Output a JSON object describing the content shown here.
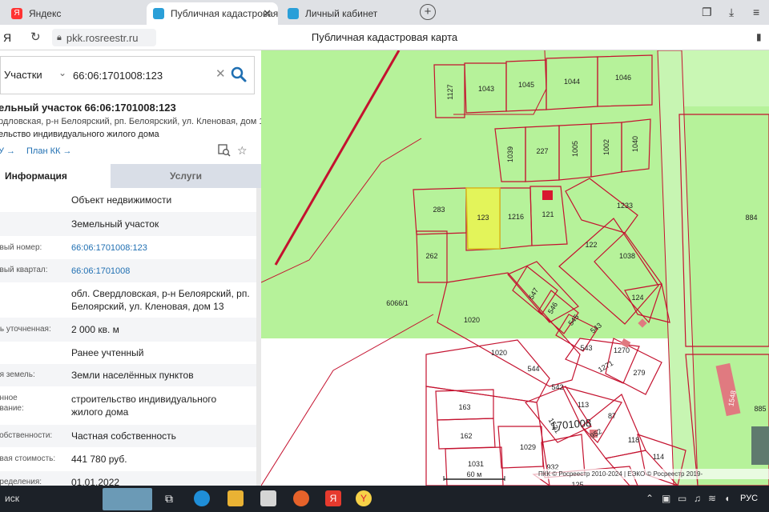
{
  "browser": {
    "tabs": [
      {
        "label": "Яндекс",
        "color": "#ff3333"
      },
      {
        "label": "Публичная кадастровая",
        "color": "#2a9fd8"
      },
      {
        "label": "Личный кабинет",
        "color": "#2a9fd8"
      }
    ],
    "url": "pkk.rosreestr.ru",
    "page_title": "Публичная кадастровая карта"
  },
  "search": {
    "type_label": "Участки",
    "value": "66:06:1701008:123"
  },
  "object": {
    "title": "ельный участок 66:06:1701008:123",
    "address": "рдловская, р-н Белоярский, рп. Белоярский, ул. Кленовая, дом 13",
    "purpose": "ельство индивидуального жилого дома",
    "link_zu": "У →",
    "link_plan": "План КК →"
  },
  "tabs": {
    "info": "Информация",
    "services": "Услуги"
  },
  "info_rows": [
    {
      "label": "",
      "value": "Объект недвижимости",
      "link": false
    },
    {
      "label": "",
      "value": "Земельный участок",
      "link": false
    },
    {
      "label": "овый номер:",
      "value": "66:06:1701008:123",
      "link": true
    },
    {
      "label": "овый квартал:",
      "value": "66:06:1701008",
      "link": true
    },
    {
      "label": "",
      "value": "обл. Свердловская, р-н Белоярский, рп. Белоярский, ул. Кленовая, дом 13",
      "link": false
    },
    {
      "label": "дь уточненная:",
      "value": "2 000 кв. м",
      "link": false
    },
    {
      "label": "",
      "value": "Ранее учтенный",
      "link": false
    },
    {
      "label": "ия земель:",
      "value": "Земли населённых пунктов",
      "link": false
    },
    {
      "label": "енное\nование:",
      "value": "строительство индивидуального жилого дома",
      "link": false
    },
    {
      "label": "собственности:",
      "value": "Частная собственность",
      "link": false
    },
    {
      "label": "овая стоимость:",
      "value": "441 780 руб.",
      "link": false
    },
    {
      "label": "пределения:",
      "value": "01.01.2022",
      "link": false
    }
  ],
  "map": {
    "parcels": [
      "1127",
      "1043",
      "1045",
      "1044",
      "1046",
      "1039",
      "227",
      "1005",
      "1002",
      "1040",
      "283",
      "123",
      "1216",
      "121",
      "1233",
      "884",
      "262",
      "122",
      "1038",
      "6066/1",
      "547",
      "546",
      "545",
      "543",
      "124",
      "1020",
      "1020",
      "543",
      "1270",
      "1271",
      "279",
      "544",
      "542",
      "113",
      "87",
      "163",
      "1701008",
      "1521",
      "952",
      "118",
      "1548",
      "885",
      "162",
      "1029",
      "1031",
      "932",
      "114",
      "125"
    ],
    "scale_label": "60 м",
    "copyright": "ПКК © Росреестр 2010-2024 | ЕЭКО © Росреестр 2019-"
  },
  "taskbar": {
    "search_text": "иск",
    "lang": "РУС"
  },
  "colors": {
    "map_green": "#b6f29a",
    "parcel_line": "#c4122f",
    "selected_parcel": "#e3f45a",
    "link_blue": "#1f6fb2"
  }
}
